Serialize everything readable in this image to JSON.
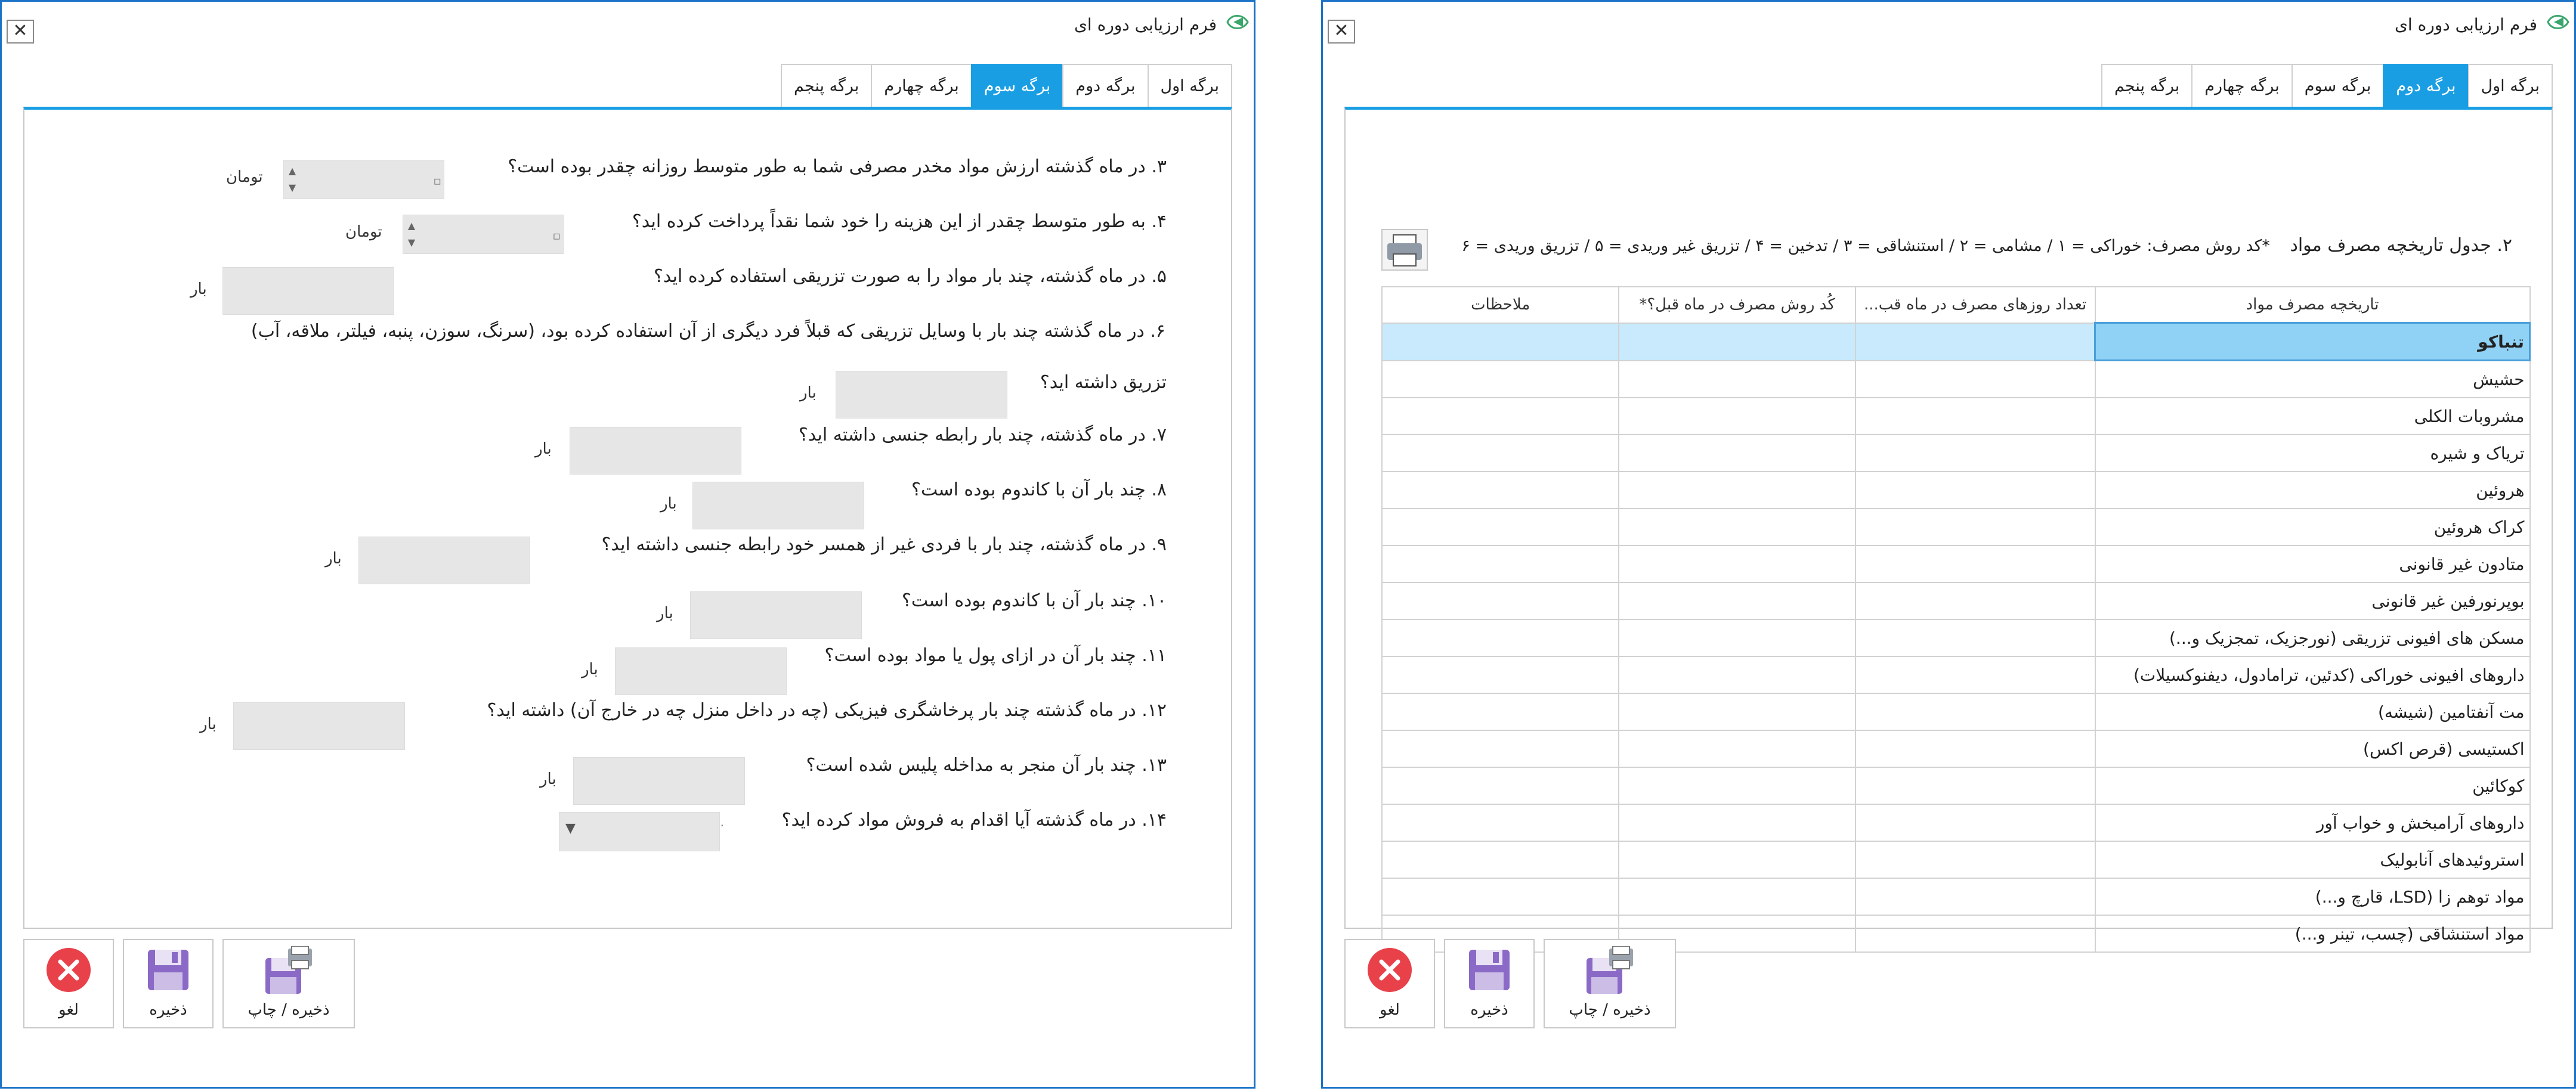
{
  "left_window": {
    "title": "فرم ارزیابی دوره ای",
    "close_label": "✕",
    "tabs": [
      {
        "label": "برگه اول",
        "active": false
      },
      {
        "label": "برگه دوم",
        "active": false
      },
      {
        "label": "برگه سوم",
        "active": true
      },
      {
        "label": "برگه چهارم",
        "active": false
      },
      {
        "label": "برگه پنجم",
        "active": false
      }
    ],
    "questions": {
      "q3": {
        "text": "۳. در ماه گذشته ارزش مواد مخدر مصرفی شما به طور متوسط روزانه چقدر بوده است؟",
        "unit": "تومان"
      },
      "q4": {
        "text": "۴. به طور متوسط چقدر از این هزینه را خود شما نقداً پرداخت کرده اید؟",
        "unit": "تومان"
      },
      "q5": {
        "text": "۵. در ماه گذشته، چند بار مواد را به صورت تزریقی استفاده کرده اید؟",
        "unit": "بار"
      },
      "q6": {
        "text": "۶. در ماه گذشته چند بار با وسایل تزریقی که قبلاً فرد دیگری از آن استفاده کرده بود، (سرنگ، سوزن، پنبه، فیلتر، ملاقه، آب)",
        "text2": "تزریق داشته اید؟",
        "unit": "بار"
      },
      "q7": {
        "text": "۷. در ماه گذشته، چند بار رابطه جنسی داشته اید؟",
        "unit": "بار"
      },
      "q8": {
        "text": "۸. چند بار آن با کاندوم بوده است؟",
        "unit": "بار"
      },
      "q9": {
        "text": "۹. در ماه گذشته، چند بار با فردی غیر از همسر خود رابطه جنسی داشته اید؟",
        "unit": "بار"
      },
      "q10": {
        "text": "۱۰. چند بار آن با کاندوم بوده است؟",
        "unit": "بار"
      },
      "q11": {
        "text": "۱۱. چند بار آن در ازای پول یا مواد بوده است؟",
        "unit": "بار"
      },
      "q12": {
        "text": "۱۲. در ماه گذشته چند بار پرخاشگری فیزیکی (چه در داخل منزل چه در خارج آن) داشته اید؟",
        "unit": "بار"
      },
      "q13": {
        "text": "۱۳. چند بار آن منجر به مداخله پلیس شده است؟",
        "unit": "بار"
      },
      "q14": {
        "text": "۱۴. در ماه گذشته آیا اقدام به فروش مواد کرده اید؟"
      }
    },
    "buttons": {
      "save_print": "ذخیره / چاپ",
      "save": "ذخیره",
      "cancel": "لغو"
    }
  },
  "right_window": {
    "title": "فرم ارزیابی دوره ای",
    "close_label": "✕",
    "tabs": [
      {
        "label": "برگه اول",
        "active": false
      },
      {
        "label": "برگه دوم",
        "active": true
      },
      {
        "label": "برگه سوم",
        "active": false
      },
      {
        "label": "برگه چهارم",
        "active": false
      },
      {
        "label": "برگه پنجم",
        "active": false
      }
    ],
    "section_caption": "۲. جدول تاریخچه مصرف مواد",
    "route_codes": "*کد روش مصرف: خوراکی = ۱ /  مشامی = ۲ / استنشاقی = ۳ / تدخین = ۴ / تزریق غیر وریدی = ۵ / تزریق وریدی = ۶",
    "table": {
      "columns": [
        "تاریخچه مصرف مواد",
        "تعداد روزهای مصرف در ماه قب...",
        "کُد روش مصرف در ماه قبل؟*",
        "ملاحظات"
      ],
      "rows": [
        "تنباکو",
        "حشیش",
        "مشروبات الکلی",
        "تریاک و شیره",
        "هروئین",
        "کراک هروئین",
        "متادون غیر قانونی",
        "بوپرنورفین غیر قانونی",
        "مسکن های افیونی تزریقی (نورجزیک، تمجزیک و...)",
        "داروهای افیونی خوراکی (کدئین، ترامادول، دیفنوکسیلات)",
        "مت آنفتامین (شیشه)",
        "اکستیسی (قرص اکس)",
        "کوکائین",
        "داروهای آرامبخش و خواب آور",
        "استروئیدهای آنابولیک",
        "مواد توهم زا (LSD، قارچ و...)",
        "مواد استنشاقی (چسب، تینر و...)"
      ],
      "selected_row": 0
    },
    "buttons": {
      "save_print": "ذخیره / چاپ",
      "save": "ذخیره",
      "cancel": "لغو"
    }
  },
  "colors": {
    "accent": "#1a9ee3",
    "window_border": "#1b73c8",
    "selected_row": "#c8eafc",
    "cancel_red": "#e8414a"
  }
}
